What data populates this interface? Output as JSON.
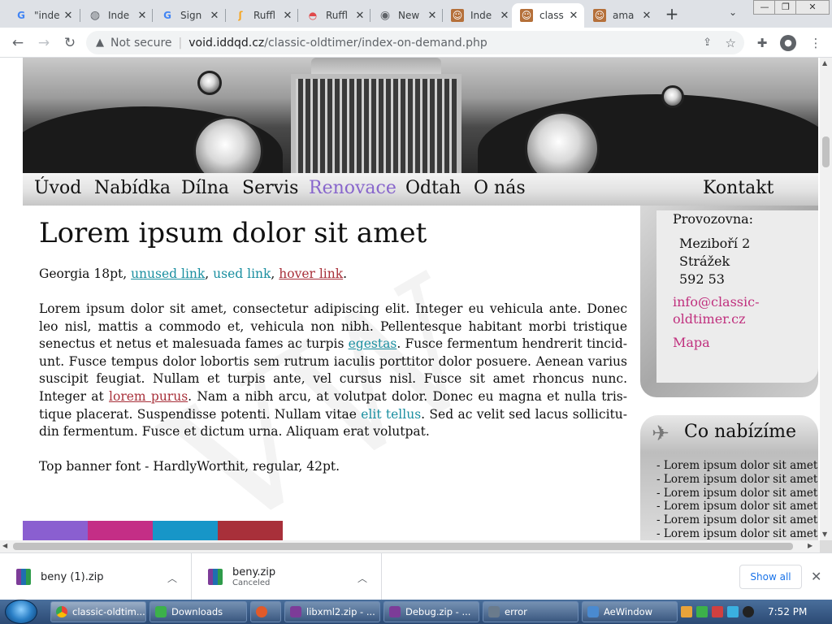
{
  "browser": {
    "tabs": [
      {
        "title": "\"inde",
        "icon": "google-icon"
      },
      {
        "title": "Inde",
        "icon": "globe-icon"
      },
      {
        "title": "Sign",
        "icon": "google-icon"
      },
      {
        "title": "Ruffl",
        "icon": "ruffle-icon"
      },
      {
        "title": "Ruffl",
        "icon": "ruffle-icon"
      },
      {
        "title": "New",
        "icon": "chrome-icon"
      },
      {
        "title": "Inde",
        "icon": "face-icon"
      },
      {
        "title": "class",
        "icon": "face-icon"
      },
      {
        "title": "ama",
        "icon": "face-icon"
      }
    ],
    "active_tab": 7,
    "security_label": "Not secure",
    "url_host": "void.iddqd.cz",
    "url_path": "/classic-oldtimer/index-on-demand.php"
  },
  "site": {
    "nav": [
      "Úvod",
      "Nabídka",
      "Dílna",
      "Servis",
      "Renovace",
      "Odtah",
      "O nás"
    ],
    "nav_active": 4,
    "nav_contact": "Kontakt",
    "title": "Lorem ipsum dolor sit amet",
    "intro_prefix": "Georgia 18pt, ",
    "link_unused": "unused link",
    "comma1": ", ",
    "link_used": "used link",
    "comma2": ", ",
    "link_hover": "hover link",
    "period": ".",
    "body_part1": "Lorem ipsum dolor sit amet, consectetur adipiscing elit. Integer eu vehicula ante. Donec leo nisl, mattis a commodo et, vehicula non nibh. Pellentesque habitant morbi tristique senectus et netus et malesuada fames ac turpis ",
    "link_egestas": "egestas",
    "body_part2": ". Fusce fermentum hendrerit tincid­unt. Fusce tempus dolor lobortis sem rutrum iaculis porttitor dolor posuere. Aenean varius suscipit feugiat. Nullam et turpis ante, vel cursus nisl. Fusce sit amet rhoncus nunc. Integer at ",
    "link_lorem": "lorem purus",
    "body_part3": ". Nam a nibh arcu, at volutpat dolor. Donec eu magna et nulla tris­tique placerat. Suspendisse potenti. Nullam vitae ",
    "link_elit": "elit tellus",
    "body_part4": ". Sed ac velit sed lacus sollicitu­din fermentum. Fusce et dictum urna. Aliquam erat volutpat.",
    "font_note": "Top banner font - HardlyWorthit, regular, 42pt.",
    "colors": [
      "#8a5fd0",
      "#c42e86",
      "#1796c8",
      "#a8303a"
    ],
    "sidebar": {
      "label": "Provozovna:",
      "address": [
        "Meziboří 2",
        "Strážek",
        "592 53"
      ],
      "email_line1": "info@classic-",
      "email_line2": "oldtimer.cz",
      "map": "Mapa",
      "offer_title": "Co nabízíme",
      "offer_items": [
        "- Lorem ipsum dolor sit amet",
        "- Lorem ipsum dolor sit amet",
        "- Lorem ipsum dolor sit amet",
        "- Lorem ipsum dolor sit amet",
        "- Lorem ipsum dolor sit amet",
        "- Lorem ipsum dolor sit amet"
      ]
    }
  },
  "downloads": [
    {
      "name": "beny (1).zip",
      "status": ""
    },
    {
      "name": "beny.zip",
      "status": "Canceled"
    }
  ],
  "show_all": "Show all",
  "taskbar": {
    "items": [
      {
        "label": "classic-oldtim...",
        "icon_color": "#e8a33a"
      },
      {
        "label": "Downloads",
        "icon_color": "#3cb14a"
      },
      {
        "label": "",
        "icon_color": "#e05a2a"
      },
      {
        "label": "libxml2.zip - ...",
        "icon_color": "#7d3c98"
      },
      {
        "label": "Debug.zip - ...",
        "icon_color": "#7d3c98"
      },
      {
        "label": "error",
        "icon_color": "#6a7b8c"
      },
      {
        "label": "AeWindow",
        "icon_color": "#4a8ad0"
      }
    ],
    "clock": "7:52 PM"
  }
}
